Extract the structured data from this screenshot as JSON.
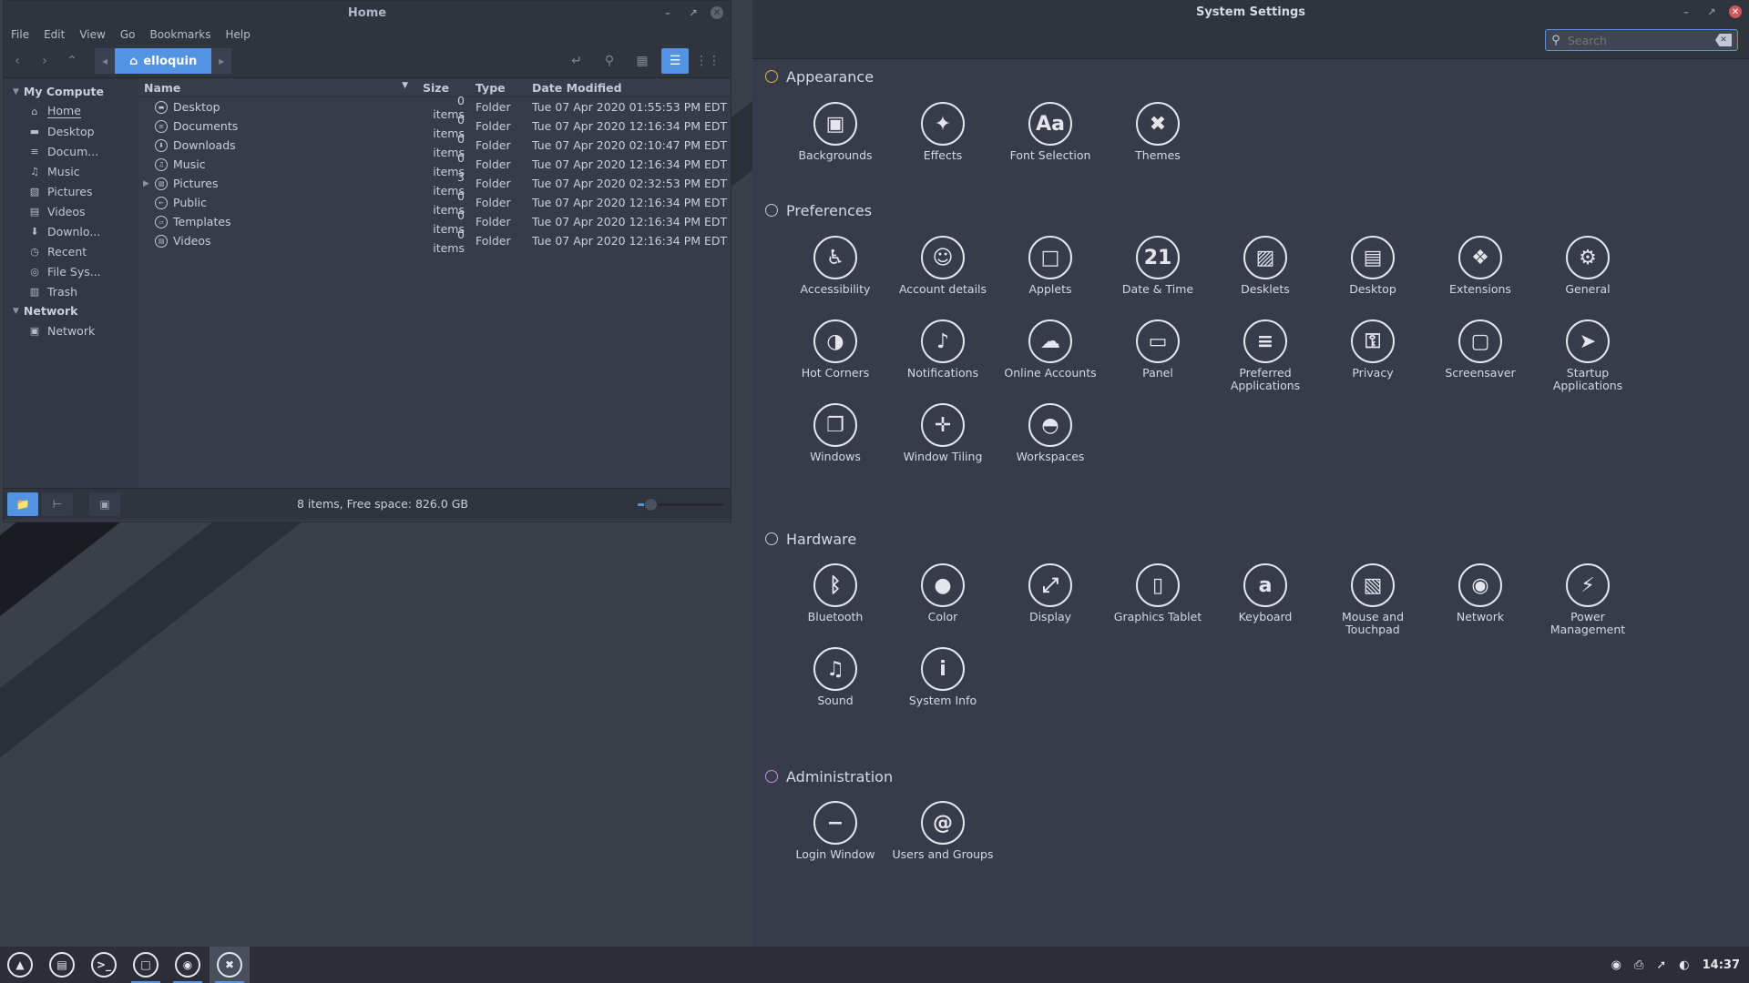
{
  "file_manager": {
    "title": "Home",
    "menu": [
      "File",
      "Edit",
      "View",
      "Go",
      "Bookmarks",
      "Help"
    ],
    "breadcrumb": "elloquin",
    "sidebar": {
      "my_computer": "My Compute",
      "places": [
        {
          "label": "Home",
          "icon": "home-icon"
        },
        {
          "label": "Desktop",
          "icon": "desktop-icon"
        },
        {
          "label": "Docum...",
          "icon": "documents-icon"
        },
        {
          "label": "Music",
          "icon": "music-icon"
        },
        {
          "label": "Pictures",
          "icon": "pictures-icon"
        },
        {
          "label": "Videos",
          "icon": "videos-icon"
        },
        {
          "label": "Downlo...",
          "icon": "downloads-icon"
        },
        {
          "label": "Recent",
          "icon": "recent-icon"
        },
        {
          "label": "File Sys...",
          "icon": "filesystem-icon"
        },
        {
          "label": "Trash",
          "icon": "trash-icon"
        }
      ],
      "network_head": "Network",
      "network_items": [
        {
          "label": "Network",
          "icon": "network-icon"
        }
      ]
    },
    "columns": {
      "name": "Name",
      "size": "Size",
      "type": "Type",
      "date": "Date Modified"
    },
    "rows": [
      {
        "name": "Desktop",
        "size": "0 items",
        "type": "Folder",
        "date": "Tue 07 Apr 2020 01:55:53 PM EDT"
      },
      {
        "name": "Documents",
        "size": "0 items",
        "type": "Folder",
        "date": "Tue 07 Apr 2020 12:16:34 PM EDT"
      },
      {
        "name": "Downloads",
        "size": "0 items",
        "type": "Folder",
        "date": "Tue 07 Apr 2020 02:10:47 PM EDT"
      },
      {
        "name": "Music",
        "size": "0 items",
        "type": "Folder",
        "date": "Tue 07 Apr 2020 12:16:34 PM EDT"
      },
      {
        "name": "Pictures",
        "size": "3 items",
        "type": "Folder",
        "date": "Tue 07 Apr 2020 02:32:53 PM EDT"
      },
      {
        "name": "Public",
        "size": "0 items",
        "type": "Folder",
        "date": "Tue 07 Apr 2020 12:16:34 PM EDT"
      },
      {
        "name": "Templates",
        "size": "0 items",
        "type": "Folder",
        "date": "Tue 07 Apr 2020 12:16:34 PM EDT"
      },
      {
        "name": "Videos",
        "size": "0 items",
        "type": "Folder",
        "date": "Tue 07 Apr 2020 12:16:34 PM EDT"
      }
    ],
    "status": "8 items, Free space: 826.0  GB",
    "zoom_level": 0.15
  },
  "settings": {
    "title": "System Settings",
    "search_placeholder": "Search",
    "sections": [
      {
        "name": "Appearance",
        "items": [
          "Backgrounds",
          "Effects",
          "Font Selection",
          "Themes"
        ]
      },
      {
        "name": "Preferences",
        "items": [
          "Accessibility",
          "Account details",
          "Applets",
          "Date & Time",
          "Desklets",
          "Desktop",
          "Extensions",
          "General",
          "Hot Corners",
          "Notifications",
          "Online Accounts",
          "Panel",
          "Preferred Applications",
          "Privacy",
          "Screensaver",
          "Startup Applications",
          "Windows",
          "Window Tiling",
          "Workspaces"
        ]
      },
      {
        "name": "Hardware",
        "items": [
          "Bluetooth",
          "Color",
          "Display",
          "Graphics Tablet",
          "Keyboard",
          "Mouse and Touchpad",
          "Network",
          "Power Management",
          "Sound",
          "System Info"
        ]
      },
      {
        "name": "Administration",
        "items": [
          "Login Window",
          "Users and Groups"
        ]
      }
    ]
  },
  "taskbar": {
    "launchers": [
      "menu-icon",
      "show-desktop-icon",
      "terminal-icon",
      "files-icon",
      "steam-icon",
      "settings-icon"
    ],
    "clock": "14:37"
  },
  "colors": {
    "accent": "#5294e2",
    "close_red": "#cc575d"
  }
}
